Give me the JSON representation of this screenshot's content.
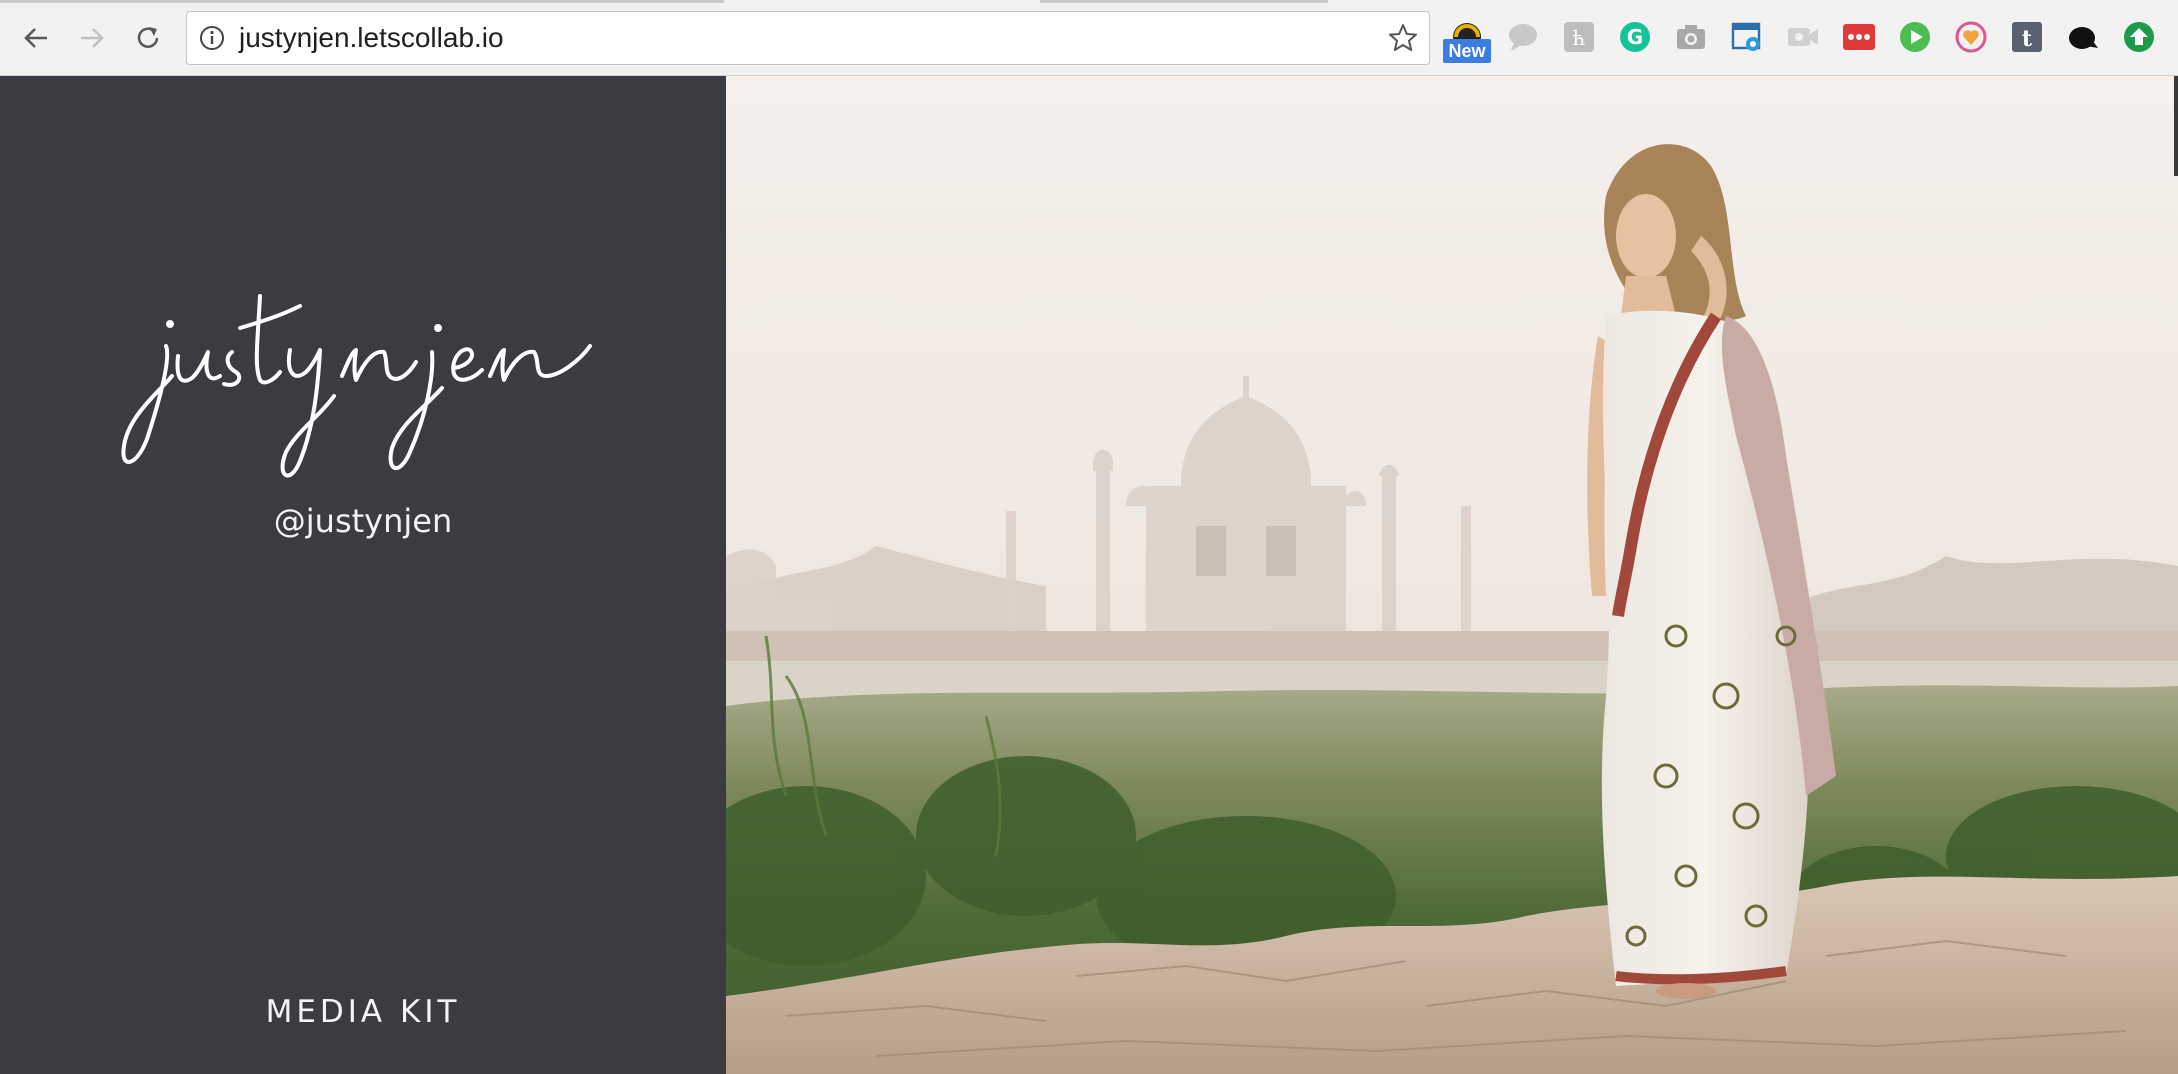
{
  "browser": {
    "url": "justynjen.letscollab.io",
    "new_badge": "New",
    "extensions": [
      "theme-icon",
      "speech-bubble-icon",
      "hootlet-icon",
      "grammarly-icon",
      "camera-icon",
      "screenshot-icon",
      "video-icon",
      "more-dots-icon",
      "play-icon",
      "instagram-heart-icon",
      "tumblr-icon",
      "black-blob-icon",
      "upload-arrow-icon"
    ],
    "colors": {
      "toolbar": "#f2f2f2",
      "badge": "#3b7de0"
    }
  },
  "sidebar": {
    "logo_text": "justynjen",
    "handle": "@justynjen",
    "media_kit": "MEDIA KIT",
    "bg": "#3c3b42"
  },
  "hero": {
    "image": "woman in white sari standing on rocks with Taj Mahal in hazy background"
  }
}
